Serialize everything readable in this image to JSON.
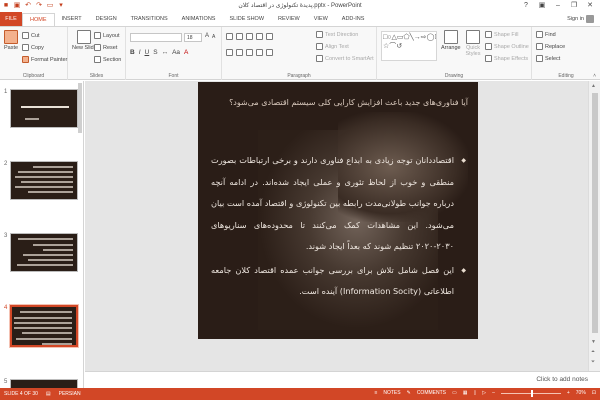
{
  "window": {
    "title": "پدیدهٔ تکنولوژی در اقتصاد کلان.pptx - PowerPoint",
    "help": "?"
  },
  "tabs": [
    "FILE",
    "HOME",
    "INSERT",
    "DESIGN",
    "TRANSITIONS",
    "ANIMATIONS",
    "SLIDE SHOW",
    "REVIEW",
    "VIEW",
    "ADD-INS"
  ],
  "user": {
    "signin": "Sign in"
  },
  "ribbon": {
    "clipboard": {
      "label": "Clipboard",
      "paste": "Paste",
      "cut": "Cut",
      "copy": "Copy",
      "format_painter": "Format Painter"
    },
    "slides": {
      "label": "Slides",
      "new_slide": "New Slide",
      "layout": "Layout",
      "reset": "Reset",
      "section": "Section"
    },
    "font": {
      "label": "Font",
      "size": "18"
    },
    "paragraph": {
      "label": "Paragraph",
      "text_direction": "Text Direction",
      "align_text": "Align Text",
      "smartart": "Convert to SmartArt"
    },
    "drawing": {
      "label": "Drawing",
      "arrange": "Arrange",
      "quick_styles": "Quick Styles",
      "shape_fill": "Shape Fill",
      "shape_outline": "Shape Outline",
      "shape_effects": "Shape Effects"
    },
    "editing": {
      "label": "Editing",
      "find": "Find",
      "replace": "Replace",
      "select": "Select"
    }
  },
  "thumbnails": [
    {
      "num": "1"
    },
    {
      "num": "2"
    },
    {
      "num": "3"
    },
    {
      "num": "4",
      "selected": true
    },
    {
      "num": "5"
    }
  ],
  "slide": {
    "question": "آیا فناوری‌های جدید باعث افزایش کارایی کلی سیستم اقتصادی می‌شود؟",
    "bullet1": "اقتصاددانان توجه زیادی به ابداع فناوری دارند و برخی ارتباطات بصورت منطقی و خوب از لحاظ تئوری و عملی ایجاد شده‌اند. در ادامه آنچه درباره جوانب طولانی‌مدت رابطه بین تکنولوژی و اقتصاد آمده است بیان می‌شود. این مشاهدات کمک می‌کنند تا محدوده‌های سناریوهای ۲۰۳۰-۲۰۲۰ تنظیم شوند که بعداً ایجاد شوند.",
    "bullet2": "این فصل شامل تلاش برای بررسی جوانب عمده اقتصاد کلان جامعه اطلاعاتی (Information Socity) آینده است."
  },
  "notes": {
    "placeholder": "Click to add notes"
  },
  "status": {
    "slide_info": "SLIDE 4 OF 30",
    "language": "PERSIAN",
    "notes_btn": "NOTES",
    "comments_btn": "COMMENTS",
    "zoom": "70%"
  },
  "colors": {
    "accent": "#d24726",
    "slide_bg": "#2a1d17"
  }
}
